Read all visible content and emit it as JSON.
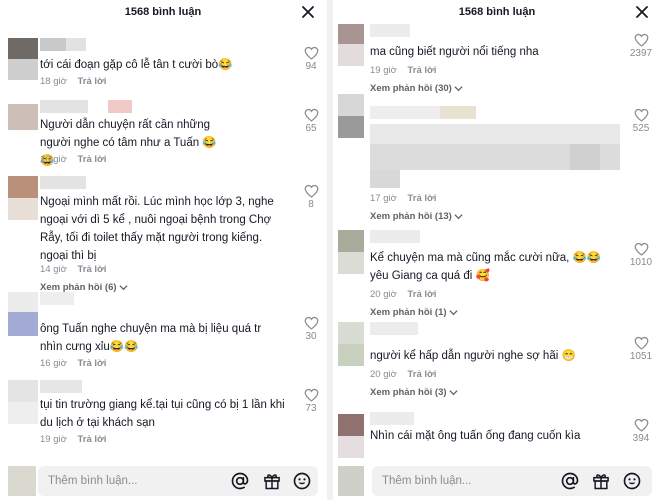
{
  "left": {
    "title": "1568 bình luận",
    "input_placeholder": "Thêm bình luận...",
    "comments": [
      {
        "text": "tới cái đoạn gặp cô lễ tân t cười bò😂",
        "time": "18 giờ",
        "reply": "Trả lời",
        "likes": "94"
      },
      {
        "text": "Người dẫn chuyện rất cần những người nghe có tâm như a Tuấn 😂😂",
        "time": "16 giờ",
        "reply": "Trả lời",
        "likes": "65"
      },
      {
        "text": "Ngoại mình mất rồi. Lúc mình học lớp 3, nghe ngoại với dì 5 kể , nuôi ngoại bệnh trong Chợ Rẫy, tối đi toilet thấy mặt người trong kiếng. ngoại thì bị",
        "time": "14 giờ",
        "reply": "Trả lời",
        "likes": "8",
        "view_replies": "Xem phản hồi (6)"
      },
      {
        "text": "ông Tuấn nghe chuyện ma mà bị liệu quá tr nhìn cưng xỉu😂😂",
        "time": "16 giờ",
        "reply": "Trả lời",
        "likes": "30"
      },
      {
        "text": "tụi tin trường giang kể.tại tụi cũng có bị 1 lần khi du lịch ở tại khách sạn",
        "time": "19 giờ",
        "reply": "Trả lời",
        "likes": "73"
      }
    ]
  },
  "right": {
    "title": "1568 bình luận",
    "input_placeholder": "Thêm bình luận...",
    "comments": [
      {
        "text": "ma cũng biết người nổi tiếng nha",
        "time": "19 giờ",
        "reply": "Trả lời",
        "likes": "2397",
        "view_replies": "Xem phản hồi (30)"
      },
      {
        "text": "",
        "time": "17 giờ",
        "reply": "Trả lời",
        "likes": "525",
        "view_replies": "Xem phản hồi (13)"
      },
      {
        "text": "Kể chuyện ma mà cũng mắc cười nữa, 😂😂 yêu Giang ca quá đi 🥰",
        "time": "20 giờ",
        "reply": "Trả lời",
        "likes": "1010",
        "view_replies": "Xem phản hồi (1)"
      },
      {
        "text": "người kể hấp dẫn người nghe sợ hãi 😁",
        "time": "20 giờ",
        "reply": "Trả lời",
        "likes": "1051",
        "view_replies": "Xem phản hồi (3)"
      },
      {
        "text": "Nhìn cái mặt ông tuấn ống đang cuốn kìa",
        "likes": "394"
      }
    ]
  },
  "icons": [
    "close-icon",
    "heart-icon",
    "chevron-down-icon",
    "at-icon",
    "gift-icon",
    "emoji-icon"
  ],
  "colors": {
    "text": "#161823",
    "muted": "#8a8b91",
    "input_bg": "#f1f1f2"
  }
}
